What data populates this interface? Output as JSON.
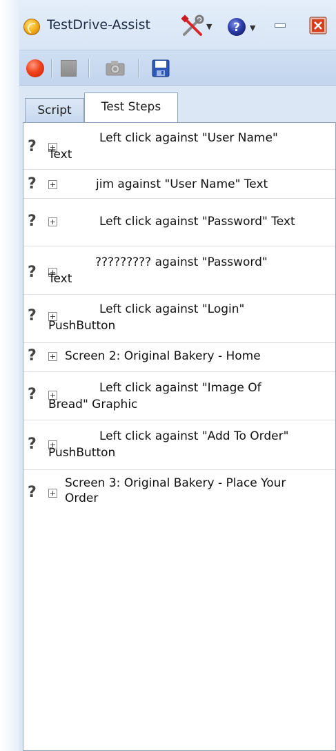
{
  "window": {
    "title": "TestDrive-Assist"
  },
  "titlebar_buttons": {
    "tools_icon": "tools-icon",
    "help_icon": "help-icon",
    "minimize_icon": "minimize-icon",
    "close_icon": "close-icon"
  },
  "toolbar": {
    "items": [
      {
        "name": "record-button",
        "icon": "record-icon"
      },
      {
        "name": "stop-button",
        "icon": "stop-icon"
      },
      {
        "name": "screenshot-button",
        "icon": "camera-icon"
      },
      {
        "name": "save-button",
        "icon": "save-icon"
      }
    ]
  },
  "tabs": [
    {
      "label": "Script",
      "active": false
    },
    {
      "label": "Test Steps",
      "active": true
    }
  ],
  "steps": [
    {
      "status_icon": "?",
      "line1": "Left click against \"User Name\"",
      "line2": "Text"
    },
    {
      "status_icon": "?",
      "line1": "jim against \"User Name\" Text",
      "line2": ""
    },
    {
      "status_icon": "?",
      "line1": "Left click against \"Password\" Text",
      "line2": ""
    },
    {
      "status_icon": "?",
      "line1": "????????? against \"Password\"",
      "line2": "Text"
    },
    {
      "status_icon": "?",
      "line1": "Left click against \"Login\"",
      "line2": "PushButton"
    },
    {
      "status_icon": "?",
      "line1": "Screen 2: Original Bakery - Home",
      "line2": ""
    },
    {
      "status_icon": "?",
      "line1": "Left click against \"Image Of",
      "line2": "Bread\" Graphic"
    },
    {
      "status_icon": "?",
      "line1": "Left click against \"Add To Order\"",
      "line2": "PushButton"
    },
    {
      "status_icon": "?",
      "line1": "Screen 3: Original Bakery - Place Your",
      "line2": "Order"
    }
  ],
  "colors": {
    "titlebar": "#dbe7f5",
    "record": "#f0421d",
    "close": "#d4401c"
  }
}
